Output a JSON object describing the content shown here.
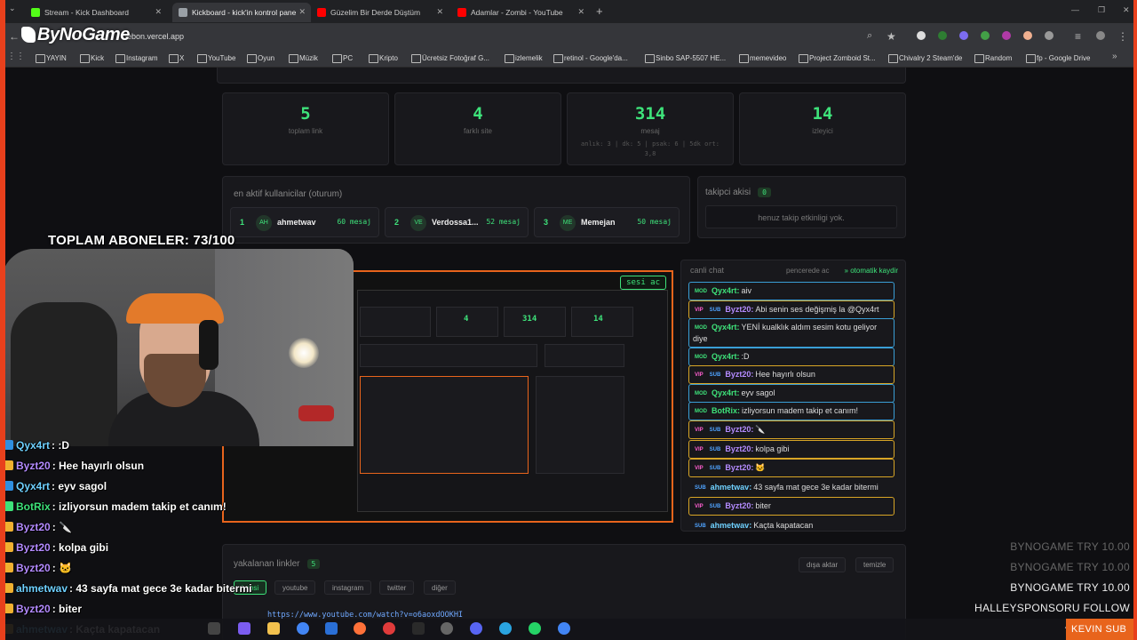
{
  "browser": {
    "tabs": [
      {
        "title": "Stream - Kick Dashboard",
        "active": false,
        "color": "#53fc18"
      },
      {
        "title": "Kickboard - kick'in kontrol pane",
        "active": true,
        "color": "#9aa0a6"
      },
      {
        "title": "Güzelim Bir Derde Düştüm",
        "active": false,
        "color": "#ff0000"
      },
      {
        "title": "Adamlar - Zombi - YouTube",
        "active": false,
        "color": "#ff0000"
      }
    ],
    "url": "-ebon.vercel.app",
    "bookmarks": [
      "YAYIN",
      "Kick",
      "Instagram",
      "X",
      "YouTube",
      "Oyun",
      "Müzik",
      "PC",
      "Kripto",
      "Ücretsiz Fotoğraf G...",
      "izlemelik",
      "retinol - Google'da...",
      "Sinbo SAP-5507 HE...",
      "memevideo",
      "Project Zomboid St...",
      "Chivalry 2 Steam'de",
      "Random",
      "fp - Google Drive"
    ]
  },
  "overlay": {
    "logo": "ByNoGame",
    "sub_goal": "TOPLAM ABONELER: 73/100",
    "chat": [
      {
        "user": "Qyx4rt",
        "text": ": :D",
        "color": "#6fd1ff",
        "icon": "mod-icon"
      },
      {
        "user": "Byzt20",
        "text": ": Hee hayırlı olsun",
        "color": "#b48bff",
        "icon": "vip-icon"
      },
      {
        "user": "Qyx4rt",
        "text": ": eyv sagol",
        "color": "#6fd1ff",
        "icon": "mod-icon"
      },
      {
        "user": "BotRix",
        "text": ": izliyorsun madem takip et canım!",
        "color": "#3ee27a",
        "icon": "bot-icon"
      },
      {
        "user": "Byzt20",
        "text": ": 🔪",
        "color": "#b48bff",
        "icon": "vip-icon"
      },
      {
        "user": "Byzt20",
        "text": ": kolpa gibi",
        "color": "#b48bff",
        "icon": "vip-icon"
      },
      {
        "user": "Byzt20",
        "text": ": 🐱",
        "color": "#b48bff",
        "icon": "vip-icon"
      },
      {
        "user": "ahmetwav",
        "text": ": 43 sayfa mat gece 3e kadar bitermi",
        "color": "#6fd1ff",
        "icon": "sub-icon"
      },
      {
        "user": "Byzt20",
        "text": ": biter",
        "color": "#b48bff",
        "icon": "vip-icon"
      },
      {
        "user": "ahmetwav",
        "text": ": Kaçta kapatacan",
        "color": "#6fd1ff",
        "icon": "sub-icon"
      }
    ],
    "tickers": [
      "BYNOGAME  TRY 10.00",
      "BYNOGAME  TRY 10.00",
      "BYNOGAME  TRY 10.00",
      "HALLEYSPONSORU  FOLLOW"
    ],
    "name_tag": "KEVIN  SUB"
  },
  "dashboard": {
    "stats": [
      {
        "value": "5",
        "label": "toplam link",
        "sub": ""
      },
      {
        "value": "4",
        "label": "farklı site",
        "sub": ""
      },
      {
        "value": "314",
        "label": "mesaj",
        "sub": "anlık: 3 | dk: 5 | psak: 6 | 5dk ort: 3,8"
      },
      {
        "value": "14",
        "label": "izleyici",
        "sub": ""
      }
    ],
    "active_users_title": "en aktif kullanicilar (oturum)",
    "active_users": [
      {
        "rank": "1",
        "initials": "AH",
        "name": "ahmetwav",
        "count": "60 mesaj"
      },
      {
        "rank": "2",
        "initials": "VE",
        "name": "Verdossa1...",
        "count": "52 mesaj"
      },
      {
        "rank": "3",
        "initials": "ME",
        "name": "Memejan",
        "count": "50 mesaj"
      }
    ],
    "follow_title": "takipci akisi",
    "follow_count": "0",
    "follow_empty": "henuz takip etkinligi yok.",
    "preview_button": "sesi ac",
    "preview_stats": [
      "4",
      "314",
      "14"
    ],
    "chat_title": "canli chat",
    "chat_popout": "pencerede ac",
    "chat_autoscroll": "otomatik kaydir",
    "chat_messages": [
      {
        "tags": [
          "MOD"
        ],
        "role": "mod",
        "user": "Qyx4rt:",
        "text": "aiv"
      },
      {
        "tags": [
          "VIP",
          "SUB"
        ],
        "role": "vip",
        "user": "Byzt20:",
        "text": "Abi senin ses değişmiş la @Qyx4rt"
      },
      {
        "tags": [
          "MOD"
        ],
        "role": "mod",
        "user": "Qyx4rt:",
        "text": "YENİ kualklık aldım sesim kotu geliyor diye"
      },
      {
        "tags": [
          "MOD"
        ],
        "role": "mod",
        "user": "Qyx4rt:",
        "text": ":D"
      },
      {
        "tags": [
          "VIP",
          "SUB"
        ],
        "role": "vip",
        "user": "Byzt20:",
        "text": "Hee hayırlı olsun"
      },
      {
        "tags": [
          "MOD"
        ],
        "role": "mod",
        "user": "Qyx4rt:",
        "text": "eyv sagol"
      },
      {
        "tags": [
          "MOD"
        ],
        "role": "mod",
        "user": "BotRix:",
        "text": "izliyorsun madem takip et canım!"
      },
      {
        "tags": [
          "VIP",
          "SUB"
        ],
        "role": "vip",
        "user": "Byzt20:",
        "text": "🔪"
      },
      {
        "tags": [
          "VIP",
          "SUB"
        ],
        "role": "vip",
        "user": "Byzt20:",
        "text": "kolpa gibi"
      },
      {
        "tags": [
          "VIP",
          "SUB"
        ],
        "role": "vip",
        "user": "Byzt20:",
        "text": "🐱"
      },
      {
        "tags": [
          "SUB"
        ],
        "role": "plain",
        "user": "ahmetwav:",
        "text": "43 sayfa mat gece 3e kadar bitermi"
      },
      {
        "tags": [
          "VIP",
          "SUB"
        ],
        "role": "vip",
        "user": "Byzt20:",
        "text": "biter"
      },
      {
        "tags": [
          "SUB"
        ],
        "role": "plain",
        "user": "ahmetwav:",
        "text": "Kaçta kapatacan"
      }
    ],
    "links_title": "yakalanan linkler",
    "links_count": "5",
    "links_filters": [
      "hepsi",
      "youtube",
      "instagram",
      "twitter",
      "diğer"
    ],
    "links_active_filter": "hepsi",
    "links_actions": [
      "dışa aktar",
      "temizle"
    ],
    "first_link": "https://www.youtube.com/watch?v=o6aoxdOOKHI"
  },
  "colors": {
    "accent": "#3ee27a",
    "frame": "#e8401c",
    "mod": "#3a9fd6",
    "vip": "#d8a526"
  }
}
